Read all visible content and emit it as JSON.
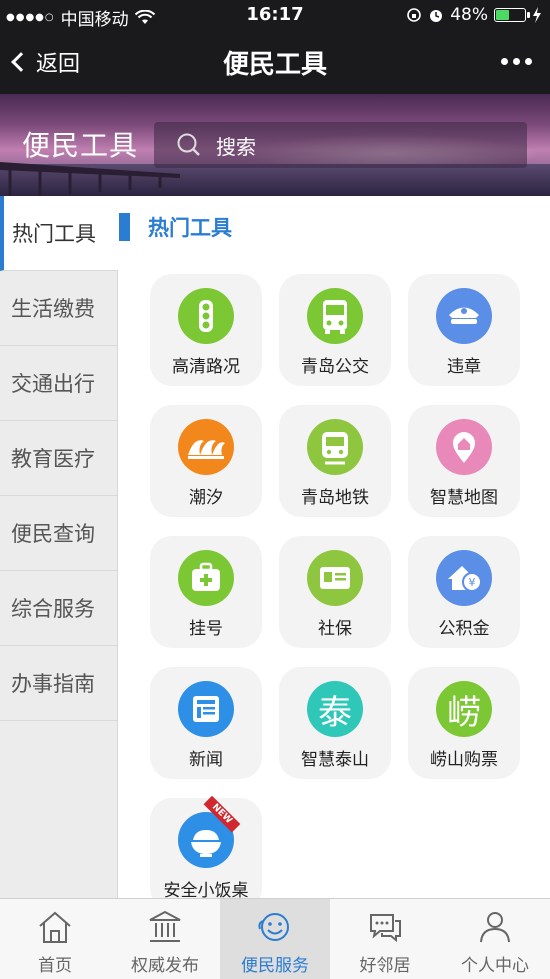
{
  "status_bar": {
    "carrier": "中国移动",
    "time": "16:17",
    "battery": "48%",
    "battery_level": 0.48
  },
  "nav": {
    "back_label": "返回",
    "title": "便民工具"
  },
  "banner": {
    "title": "便民工具",
    "search_placeholder": "搜索"
  },
  "sidebar": {
    "items": [
      {
        "label": "热门工具",
        "active": true
      },
      {
        "label": "生活缴费"
      },
      {
        "label": "交通出行"
      },
      {
        "label": "教育医疗"
      },
      {
        "label": "便民查询"
      },
      {
        "label": "综合服务"
      },
      {
        "label": "办事指南"
      }
    ]
  },
  "section": {
    "title": "热门工具"
  },
  "tools": [
    {
      "label": "高清路况",
      "icon": "traffic-light-icon",
      "color": "#7cc734"
    },
    {
      "label": "青岛公交",
      "icon": "bus-icon",
      "color": "#7cc734"
    },
    {
      "label": "违章",
      "icon": "police-cap-icon",
      "color": "#5b8ee6"
    },
    {
      "label": "潮汐",
      "icon": "wave-icon",
      "color": "#f2871c"
    },
    {
      "label": "青岛地铁",
      "icon": "metro-icon",
      "color": "#8ec63f"
    },
    {
      "label": "智慧地图",
      "icon": "map-pin-icon",
      "color": "#e889b9"
    },
    {
      "label": "挂号",
      "icon": "medical-kit-icon",
      "color": "#7cc734"
    },
    {
      "label": "社保",
      "icon": "id-card-icon",
      "color": "#8ec63f"
    },
    {
      "label": "公积金",
      "icon": "house-fund-icon",
      "color": "#5b8ee6"
    },
    {
      "label": "新闻",
      "icon": "newspaper-icon",
      "color": "#2e8fe6"
    },
    {
      "label": "智慧泰山",
      "icon": "tai-glyph-icon",
      "glyph": "泰",
      "color": "#2ec7b8"
    },
    {
      "label": "崂山购票",
      "icon": "lao-glyph-icon",
      "glyph": "崂",
      "color": "#7cc734"
    },
    {
      "label": "安全小饭桌",
      "icon": "rice-bowl-icon",
      "color": "#2e8fe6",
      "badge": "NEW"
    }
  ],
  "tabs": [
    {
      "label": "首页",
      "icon": "home-icon"
    },
    {
      "label": "权威发布",
      "icon": "government-building-icon"
    },
    {
      "label": "便民服务",
      "icon": "smile-service-icon",
      "active": true
    },
    {
      "label": "好邻居",
      "icon": "chat-bubbles-icon"
    },
    {
      "label": "个人中心",
      "icon": "person-icon"
    }
  ],
  "colors": {
    "accent": "#2b7dd1",
    "bar_bg": "#1a1a1c"
  }
}
